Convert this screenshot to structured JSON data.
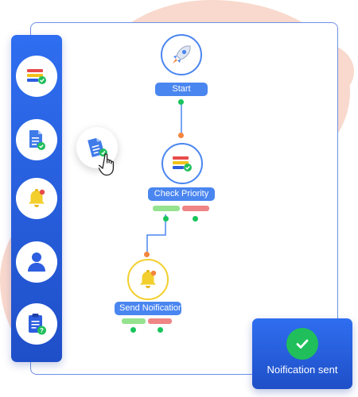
{
  "app": {
    "canvas_title": "",
    "colors": {
      "accent": "#4a86f0",
      "sidebar": "#2563eb",
      "success": "#20bf5b",
      "warning": "#f2cf2c",
      "decor_blob": "#f9d9cd"
    }
  },
  "sidebar": {
    "items": [
      {
        "name": "priority-tool",
        "icon": "priority-bars-icon"
      },
      {
        "name": "document-tool",
        "icon": "document-check-icon"
      },
      {
        "name": "notification-tool",
        "icon": "bell-icon"
      },
      {
        "name": "user-tool",
        "icon": "user-icon"
      },
      {
        "name": "clipboard-tool",
        "icon": "clipboard-question-icon"
      }
    ]
  },
  "flow": {
    "nodes": [
      {
        "id": "start",
        "label": "Start",
        "icon": "rocket-icon"
      },
      {
        "id": "check-priority",
        "label": "Check Priority",
        "icon": "priority-bars-icon"
      },
      {
        "id": "send-notification",
        "label": "Send Noification",
        "icon": "bell-icon"
      }
    ],
    "dragging_item": "document-check-icon"
  },
  "toast": {
    "message": "Noification sent",
    "icon": "checkmark-icon"
  }
}
